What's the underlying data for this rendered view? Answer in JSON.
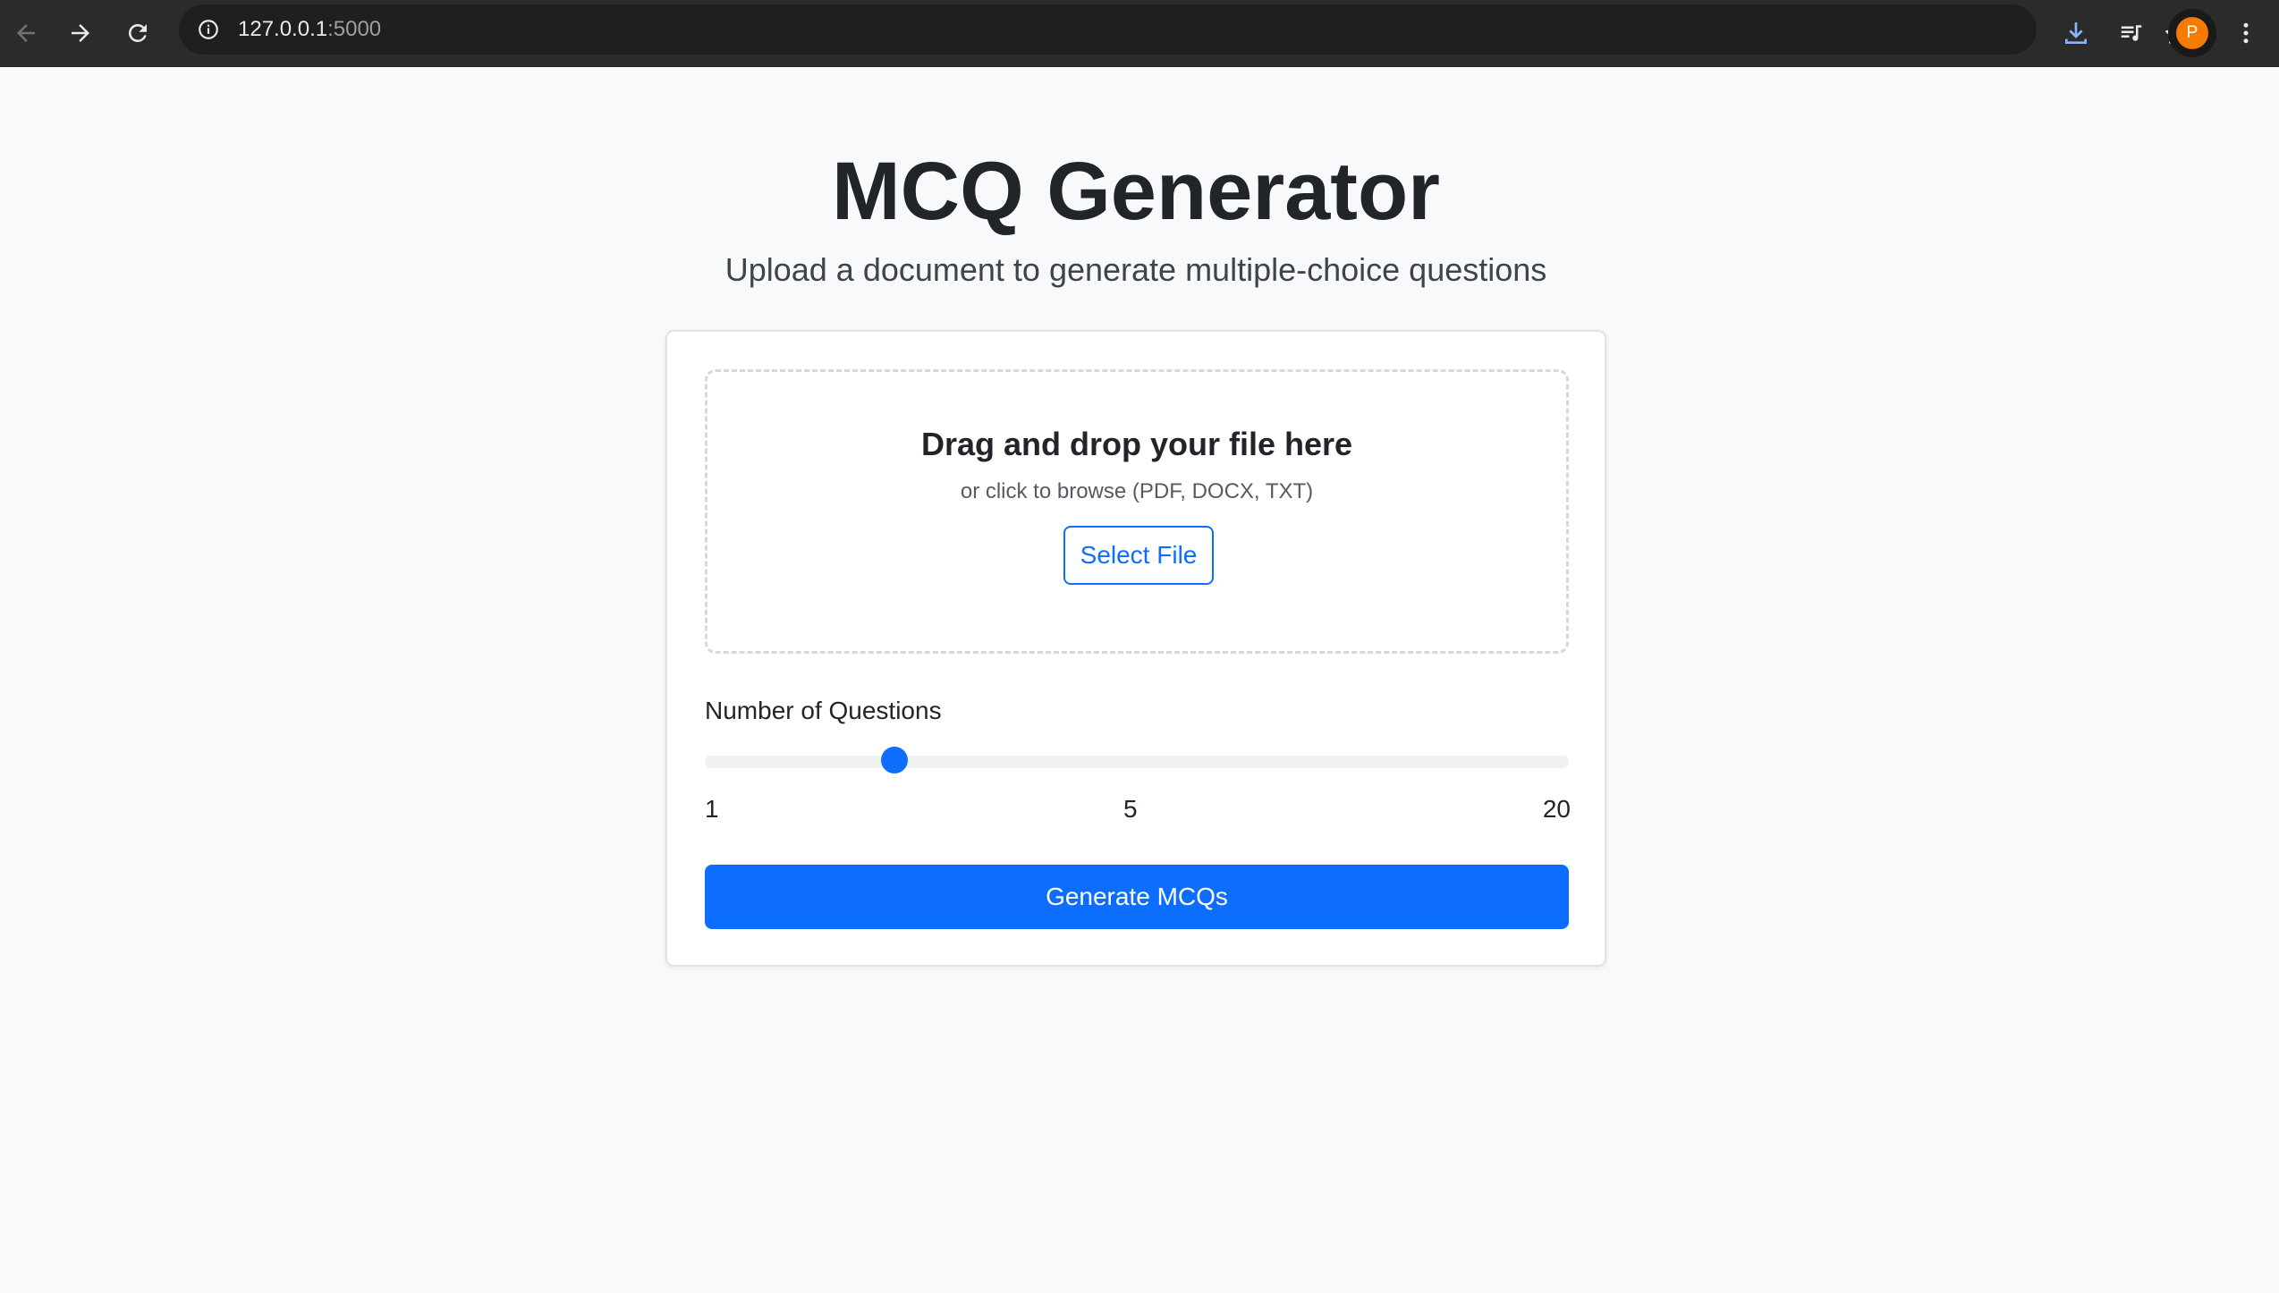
{
  "browser": {
    "url_host": "127.0.0.1",
    "url_port": ":5000",
    "avatar_initial": "P"
  },
  "page": {
    "title": "MCQ Generator",
    "subtitle": "Upload a document to generate multiple-choice questions"
  },
  "upload": {
    "title": "Drag and drop your file here",
    "subtitle": "or click to browse (PDF, DOCX, TXT)",
    "button_label": "Select File"
  },
  "questions": {
    "label": "Number of Questions",
    "min_label": "1",
    "mid_label": "5",
    "max_label": "20",
    "min": 1,
    "max": 20,
    "value": 5
  },
  "generate_button_label": "Generate MCQs",
  "colors": {
    "primary": "#0d6efd",
    "avatar": "#f57c00"
  }
}
